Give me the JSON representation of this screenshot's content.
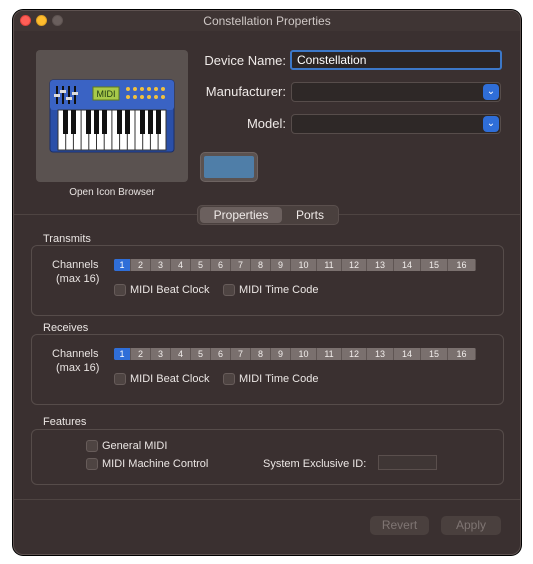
{
  "window": {
    "title": "Constellation Properties"
  },
  "icon": {
    "caption": "Open Icon Browser",
    "image": "keyboard-synth-icon"
  },
  "form": {
    "device_name_label": "Device Name:",
    "device_name_value": "Constellation",
    "manufacturer_label": "Manufacturer:",
    "manufacturer_value": "",
    "model_label": "Model:",
    "model_value": "",
    "color_swatch": "#4f7ea8"
  },
  "tabs": [
    {
      "label": "Properties",
      "selected": true
    },
    {
      "label": "Ports",
      "selected": false
    }
  ],
  "transmits": {
    "section_title": "Transmits",
    "channels_label": "Channels",
    "channels_sub": "(max 16)",
    "channels": [
      "1",
      "2",
      "3",
      "4",
      "5",
      "6",
      "7",
      "8",
      "9",
      "10",
      "11",
      "12",
      "13",
      "14",
      "15",
      "16"
    ],
    "selected_channel": "1",
    "beat_clock_label": "MIDI Beat Clock",
    "time_code_label": "MIDI Time Code"
  },
  "receives": {
    "section_title": "Receives",
    "channels_label": "Channels",
    "channels_sub": "(max 16)",
    "channels": [
      "1",
      "2",
      "3",
      "4",
      "5",
      "6",
      "7",
      "8",
      "9",
      "10",
      "11",
      "12",
      "13",
      "14",
      "15",
      "16"
    ],
    "selected_channel": "1",
    "beat_clock_label": "MIDI Beat Clock",
    "time_code_label": "MIDI Time Code"
  },
  "features": {
    "section_title": "Features",
    "general_midi_label": "General MIDI",
    "machine_control_label": "MIDI Machine Control",
    "sysex_label": "System Exclusive ID:",
    "sysex_value": ""
  },
  "buttons": {
    "revert_label": "Revert",
    "apply_label": "Apply"
  },
  "colors": {
    "accent": "#2f6ed8",
    "background": "#3a3030",
    "selected_channel": "#2f6ed8"
  }
}
